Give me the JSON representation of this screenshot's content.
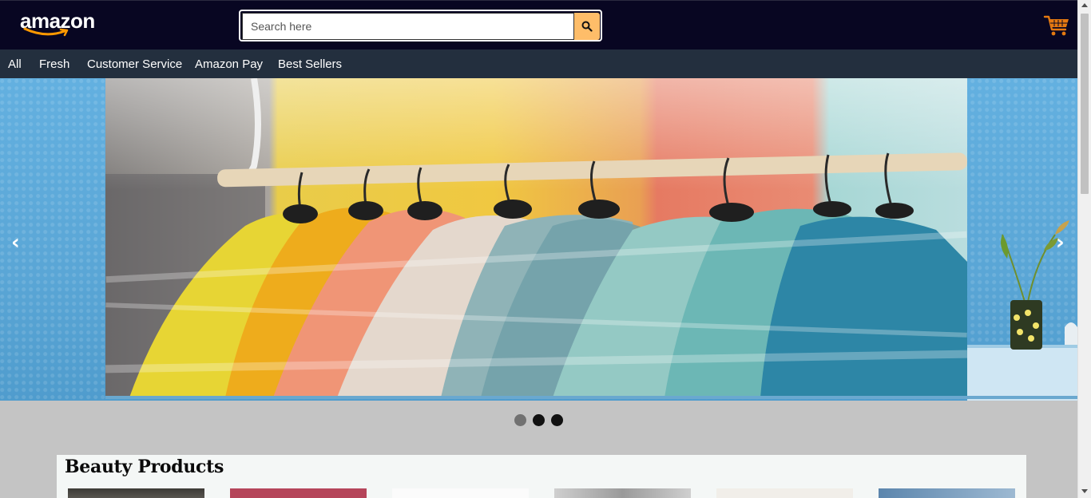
{
  "header": {
    "logo_text": "amazon",
    "search_placeholder": "Search here",
    "search_value": "",
    "icons": {
      "search": "search-icon",
      "cart": "cart-icon"
    },
    "colors": {
      "topbar": "#080622",
      "search_button": "#febd69",
      "cart": "#e47911"
    }
  },
  "nav": {
    "items": [
      {
        "label": "All"
      },
      {
        "label": "Fresh"
      },
      {
        "label": "Customer Service"
      },
      {
        "label": "Amazon Pay"
      },
      {
        "label": "Best Sellers"
      }
    ],
    "color": "#232f3e"
  },
  "carousel": {
    "prev_arrow": "‹",
    "next_arrow": "›",
    "slide_count": 3,
    "active_slide": 1,
    "image_subject": "colorful puffer jackets hanging on a rack"
  },
  "sections": [
    {
      "title": "Beauty Products",
      "thumbnail_count": 6
    }
  ]
}
